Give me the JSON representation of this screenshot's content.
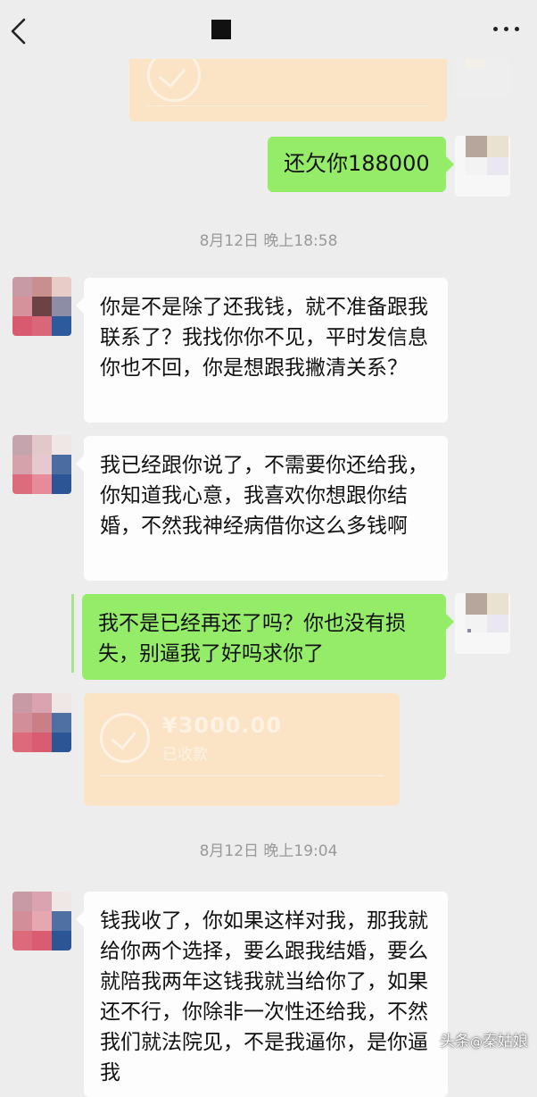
{
  "header": {
    "back_icon": "chevron-left-icon",
    "more_icon": "more-dots-icon"
  },
  "messages": [
    {
      "type": "transfer",
      "side": "right",
      "status": "redacted"
    },
    {
      "type": "text",
      "side": "right",
      "text": "还欠你188000"
    },
    {
      "type": "timestamp",
      "text": "8月12日 晚上18:58"
    },
    {
      "type": "text",
      "side": "left",
      "text": "你是不是除了还我钱，就不准备跟我联系了？我找你你不见，平时发信息你也不回，你是想跟我撇清关系？"
    },
    {
      "type": "text",
      "side": "left",
      "text": "我已经跟你说了，不需要你还给我，你知道我心意，我喜欢你想跟你结婚，不然我神经病借你这么多钱啊"
    },
    {
      "type": "text",
      "side": "right",
      "text": "我不是已经再还了吗？你也没有损失，别逼我了好吗求你了"
    },
    {
      "type": "transfer",
      "side": "left",
      "amount": "¥3000.00",
      "status": "已收款"
    },
    {
      "type": "timestamp",
      "text": "8月12日 晚上19:04"
    },
    {
      "type": "text",
      "side": "left",
      "text": "钱我收了，你如果这样对我，那我就给你两个选择，要么跟我结婚，要么就陪我两年这钱我就当给你了，如果还不行，你除非一次性还给我，不然我们就法院见，不是我逼你，是你逼我"
    }
  ],
  "watermark": {
    "prefix": "头条",
    "at": "@",
    "author": "秦姑娘"
  }
}
